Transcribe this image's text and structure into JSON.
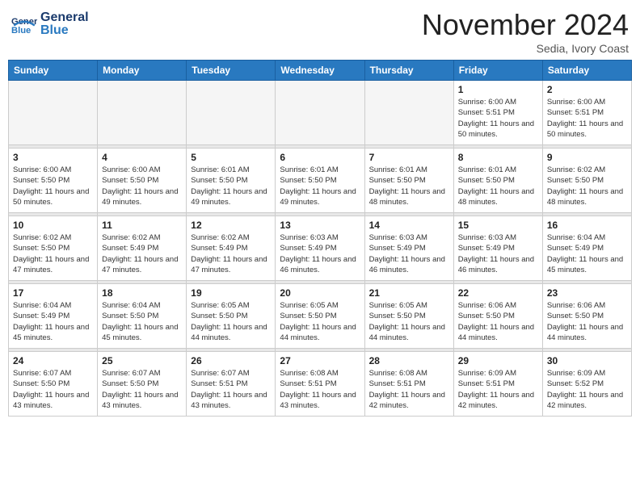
{
  "header": {
    "logo_general": "General",
    "logo_blue": "Blue",
    "month_title": "November 2024",
    "location": "Sedia, Ivory Coast"
  },
  "days_of_week": [
    "Sunday",
    "Monday",
    "Tuesday",
    "Wednesday",
    "Thursday",
    "Friday",
    "Saturday"
  ],
  "weeks": [
    [
      {
        "num": "",
        "sunrise": "",
        "sunset": "",
        "daylight": "",
        "empty": true
      },
      {
        "num": "",
        "sunrise": "",
        "sunset": "",
        "daylight": "",
        "empty": true
      },
      {
        "num": "",
        "sunrise": "",
        "sunset": "",
        "daylight": "",
        "empty": true
      },
      {
        "num": "",
        "sunrise": "",
        "sunset": "",
        "daylight": "",
        "empty": true
      },
      {
        "num": "",
        "sunrise": "",
        "sunset": "",
        "daylight": "",
        "empty": true
      },
      {
        "num": "1",
        "sunrise": "Sunrise: 6:00 AM",
        "sunset": "Sunset: 5:51 PM",
        "daylight": "Daylight: 11 hours and 50 minutes.",
        "empty": false
      },
      {
        "num": "2",
        "sunrise": "Sunrise: 6:00 AM",
        "sunset": "Sunset: 5:51 PM",
        "daylight": "Daylight: 11 hours and 50 minutes.",
        "empty": false
      }
    ],
    [
      {
        "num": "3",
        "sunrise": "Sunrise: 6:00 AM",
        "sunset": "Sunset: 5:50 PM",
        "daylight": "Daylight: 11 hours and 50 minutes.",
        "empty": false
      },
      {
        "num": "4",
        "sunrise": "Sunrise: 6:00 AM",
        "sunset": "Sunset: 5:50 PM",
        "daylight": "Daylight: 11 hours and 49 minutes.",
        "empty": false
      },
      {
        "num": "5",
        "sunrise": "Sunrise: 6:01 AM",
        "sunset": "Sunset: 5:50 PM",
        "daylight": "Daylight: 11 hours and 49 minutes.",
        "empty": false
      },
      {
        "num": "6",
        "sunrise": "Sunrise: 6:01 AM",
        "sunset": "Sunset: 5:50 PM",
        "daylight": "Daylight: 11 hours and 49 minutes.",
        "empty": false
      },
      {
        "num": "7",
        "sunrise": "Sunrise: 6:01 AM",
        "sunset": "Sunset: 5:50 PM",
        "daylight": "Daylight: 11 hours and 48 minutes.",
        "empty": false
      },
      {
        "num": "8",
        "sunrise": "Sunrise: 6:01 AM",
        "sunset": "Sunset: 5:50 PM",
        "daylight": "Daylight: 11 hours and 48 minutes.",
        "empty": false
      },
      {
        "num": "9",
        "sunrise": "Sunrise: 6:02 AM",
        "sunset": "Sunset: 5:50 PM",
        "daylight": "Daylight: 11 hours and 48 minutes.",
        "empty": false
      }
    ],
    [
      {
        "num": "10",
        "sunrise": "Sunrise: 6:02 AM",
        "sunset": "Sunset: 5:50 PM",
        "daylight": "Daylight: 11 hours and 47 minutes.",
        "empty": false
      },
      {
        "num": "11",
        "sunrise": "Sunrise: 6:02 AM",
        "sunset": "Sunset: 5:49 PM",
        "daylight": "Daylight: 11 hours and 47 minutes.",
        "empty": false
      },
      {
        "num": "12",
        "sunrise": "Sunrise: 6:02 AM",
        "sunset": "Sunset: 5:49 PM",
        "daylight": "Daylight: 11 hours and 47 minutes.",
        "empty": false
      },
      {
        "num": "13",
        "sunrise": "Sunrise: 6:03 AM",
        "sunset": "Sunset: 5:49 PM",
        "daylight": "Daylight: 11 hours and 46 minutes.",
        "empty": false
      },
      {
        "num": "14",
        "sunrise": "Sunrise: 6:03 AM",
        "sunset": "Sunset: 5:49 PM",
        "daylight": "Daylight: 11 hours and 46 minutes.",
        "empty": false
      },
      {
        "num": "15",
        "sunrise": "Sunrise: 6:03 AM",
        "sunset": "Sunset: 5:49 PM",
        "daylight": "Daylight: 11 hours and 46 minutes.",
        "empty": false
      },
      {
        "num": "16",
        "sunrise": "Sunrise: 6:04 AM",
        "sunset": "Sunset: 5:49 PM",
        "daylight": "Daylight: 11 hours and 45 minutes.",
        "empty": false
      }
    ],
    [
      {
        "num": "17",
        "sunrise": "Sunrise: 6:04 AM",
        "sunset": "Sunset: 5:49 PM",
        "daylight": "Daylight: 11 hours and 45 minutes.",
        "empty": false
      },
      {
        "num": "18",
        "sunrise": "Sunrise: 6:04 AM",
        "sunset": "Sunset: 5:50 PM",
        "daylight": "Daylight: 11 hours and 45 minutes.",
        "empty": false
      },
      {
        "num": "19",
        "sunrise": "Sunrise: 6:05 AM",
        "sunset": "Sunset: 5:50 PM",
        "daylight": "Daylight: 11 hours and 44 minutes.",
        "empty": false
      },
      {
        "num": "20",
        "sunrise": "Sunrise: 6:05 AM",
        "sunset": "Sunset: 5:50 PM",
        "daylight": "Daylight: 11 hours and 44 minutes.",
        "empty": false
      },
      {
        "num": "21",
        "sunrise": "Sunrise: 6:05 AM",
        "sunset": "Sunset: 5:50 PM",
        "daylight": "Daylight: 11 hours and 44 minutes.",
        "empty": false
      },
      {
        "num": "22",
        "sunrise": "Sunrise: 6:06 AM",
        "sunset": "Sunset: 5:50 PM",
        "daylight": "Daylight: 11 hours and 44 minutes.",
        "empty": false
      },
      {
        "num": "23",
        "sunrise": "Sunrise: 6:06 AM",
        "sunset": "Sunset: 5:50 PM",
        "daylight": "Daylight: 11 hours and 44 minutes.",
        "empty": false
      }
    ],
    [
      {
        "num": "24",
        "sunrise": "Sunrise: 6:07 AM",
        "sunset": "Sunset: 5:50 PM",
        "daylight": "Daylight: 11 hours and 43 minutes.",
        "empty": false
      },
      {
        "num": "25",
        "sunrise": "Sunrise: 6:07 AM",
        "sunset": "Sunset: 5:50 PM",
        "daylight": "Daylight: 11 hours and 43 minutes.",
        "empty": false
      },
      {
        "num": "26",
        "sunrise": "Sunrise: 6:07 AM",
        "sunset": "Sunset: 5:51 PM",
        "daylight": "Daylight: 11 hours and 43 minutes.",
        "empty": false
      },
      {
        "num": "27",
        "sunrise": "Sunrise: 6:08 AM",
        "sunset": "Sunset: 5:51 PM",
        "daylight": "Daylight: 11 hours and 43 minutes.",
        "empty": false
      },
      {
        "num": "28",
        "sunrise": "Sunrise: 6:08 AM",
        "sunset": "Sunset: 5:51 PM",
        "daylight": "Daylight: 11 hours and 42 minutes.",
        "empty": false
      },
      {
        "num": "29",
        "sunrise": "Sunrise: 6:09 AM",
        "sunset": "Sunset: 5:51 PM",
        "daylight": "Daylight: 11 hours and 42 minutes.",
        "empty": false
      },
      {
        "num": "30",
        "sunrise": "Sunrise: 6:09 AM",
        "sunset": "Sunset: 5:52 PM",
        "daylight": "Daylight: 11 hours and 42 minutes.",
        "empty": false
      }
    ]
  ]
}
